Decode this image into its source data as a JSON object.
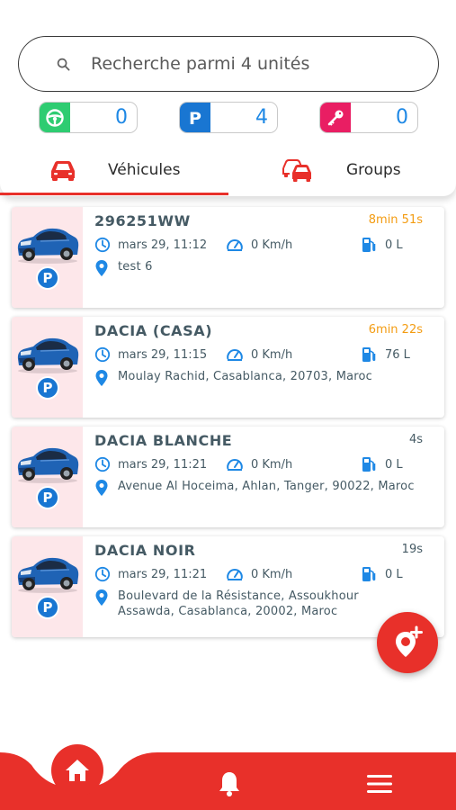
{
  "colors": {
    "accent": "#e8302a",
    "blue": "#1e88e5",
    "orange": "#f39c12",
    "text": "#455a64"
  },
  "search": {
    "placeholder": "Recherche parmi 4 unités"
  },
  "stats": [
    {
      "icon": "steering-wheel-icon",
      "value": "0",
      "color": "#2ecc71"
    },
    {
      "icon": "parking-icon",
      "value": "4",
      "color": "#1976d2"
    },
    {
      "icon": "key-icon",
      "value": "0",
      "color": "#e91e63"
    }
  ],
  "tabs": [
    {
      "icon": "car-icon",
      "label": "Véhicules",
      "active": true
    },
    {
      "icon": "group-cars-icon",
      "label": "Groups",
      "active": false
    }
  ],
  "vehicles": [
    {
      "name": "296251WW",
      "elapsed": "8min 51s",
      "elapsed_color": "#f39c12",
      "time": "mars 29, 11:12",
      "speed": "0 Km/h",
      "fuel": "0 L",
      "address": "test 6",
      "status": "P"
    },
    {
      "name": "DACIA (CASA)",
      "elapsed": "6min 22s",
      "elapsed_color": "#f39c12",
      "time": "mars 29, 11:15",
      "speed": "0 Km/h",
      "fuel": "76 L",
      "address": "Moulay Rachid, Casablanca, 20703, Maroc",
      "status": "P"
    },
    {
      "name": "DACIA BLANCHE",
      "elapsed": "4s",
      "elapsed_color": "#455a64",
      "time": "mars 29, 11:21",
      "speed": "0 Km/h",
      "fuel": "0 L",
      "address": "Avenue Al Hoceima, Ahlan, Tanger, 90022, Maroc",
      "status": "P"
    },
    {
      "name": "DACIA NOIR",
      "elapsed": "19s",
      "elapsed_color": "#455a64",
      "time": "mars 29, 11:21",
      "speed": "0 Km/h",
      "fuel": "0 L",
      "address": "Boulevard de la Résistance, Assoukhour Assawda, Casablanca, 20002, Maroc",
      "status": "P"
    }
  ],
  "fab": {
    "icon": "add-location-icon"
  },
  "bottom_nav": [
    {
      "icon": "home-icon",
      "active": true
    },
    {
      "icon": "bell-icon",
      "active": false
    },
    {
      "icon": "menu-icon",
      "active": false
    }
  ]
}
